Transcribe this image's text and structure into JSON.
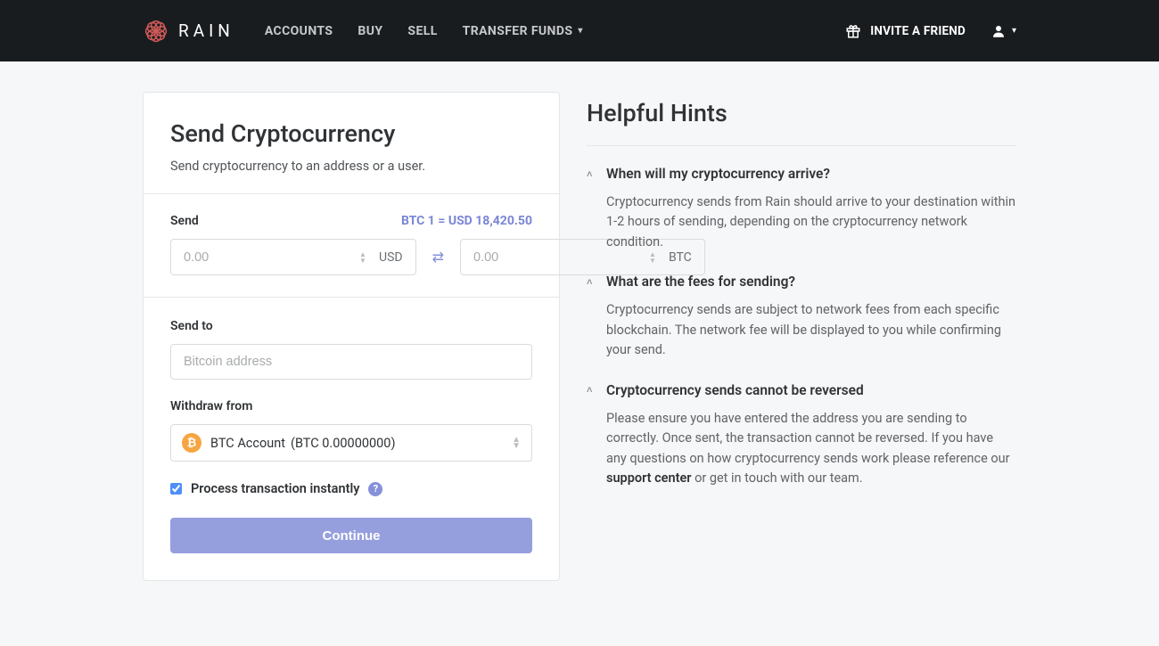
{
  "nav": {
    "brand": "RAIN",
    "items": [
      "ACCOUNTS",
      "BUY",
      "SELL",
      "TRANSFER FUNDS"
    ],
    "invite": "INVITE A FRIEND"
  },
  "card": {
    "title": "Send Cryptocurrency",
    "subtitle": "Send cryptocurrency to an address or a user.",
    "send_label": "Send",
    "rate": "BTC 1 = USD 18,420.50",
    "usd_placeholder": "0.00",
    "usd_cur": "USD",
    "btc_placeholder": "0.00",
    "btc_cur": "BTC",
    "send_to_label": "Send to",
    "address_placeholder": "Bitcoin address",
    "withdraw_label": "Withdraw from",
    "account_name": "BTC Account",
    "account_balance": "(BTC 0.00000000)",
    "instant_label": "Process transaction instantly",
    "continue": "Continue"
  },
  "hints": {
    "title": "Helpful Hints",
    "items": [
      {
        "q": "When will my cryptocurrency arrive?",
        "a": "Cryptocurrency sends from Rain should arrive to your destination within 1-2 hours of sending, depending on the cryptocurrency network condition."
      },
      {
        "q": "What are the fees for sending?",
        "a": "Cryptocurrency sends are subject to network fees from each specific blockchain. The network fee will be displayed to you while confirming your send."
      },
      {
        "q": "Cryptocurrency sends cannot be reversed",
        "a_pre": "Please ensure you have entered the address you are sending to correctly. Once sent, the transaction cannot be reversed. If you have any questions on how cryptocurrency sends work please reference our ",
        "a_link": "support center",
        "a_post": " or get in touch with our team."
      }
    ]
  }
}
